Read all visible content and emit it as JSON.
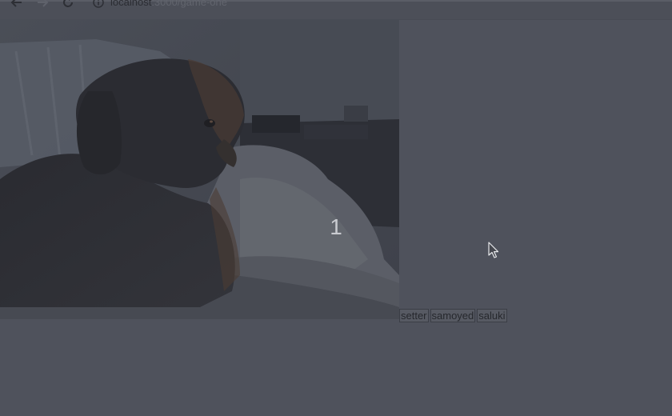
{
  "browser": {
    "url_host": "localhost",
    "url_path": ":3000/game-one",
    "back_icon": "arrow-left-icon",
    "forward_icon": "arrow-right-icon",
    "reload_icon": "reload-icon",
    "info_icon": "info-icon"
  },
  "game": {
    "countdown": "1",
    "answers": [
      "setter",
      "samoyed",
      "saluki"
    ]
  },
  "colors": {
    "background": "#4f525c",
    "button_text": "#26282d",
    "countdown_text": "#c9cbd0"
  }
}
